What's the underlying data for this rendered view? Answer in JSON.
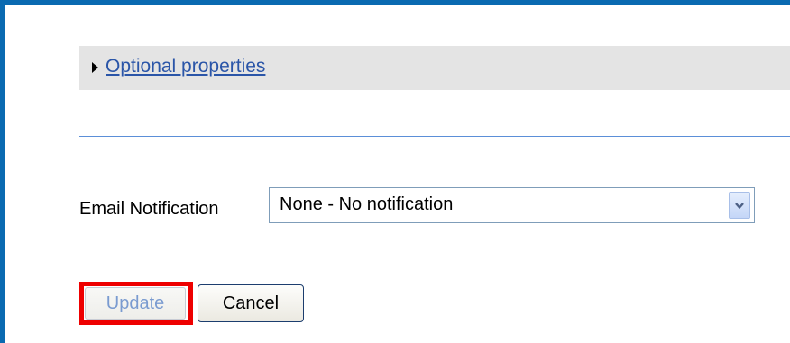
{
  "optional_properties": {
    "link_text": "Optional properties",
    "expander_icon": "triangle-right-icon"
  },
  "email_notification": {
    "label": "Email Notification",
    "selected_value": "None - No notification",
    "dropdown_icon": "chevron-down-icon"
  },
  "buttons": {
    "update_label": "Update",
    "cancel_label": "Cancel"
  },
  "colors": {
    "frame_border": "#0a6ab1",
    "link": "#2a55a8",
    "divider": "#5b8fd8",
    "highlight": "#ee0000",
    "bar_background": "#e4e4e4"
  }
}
